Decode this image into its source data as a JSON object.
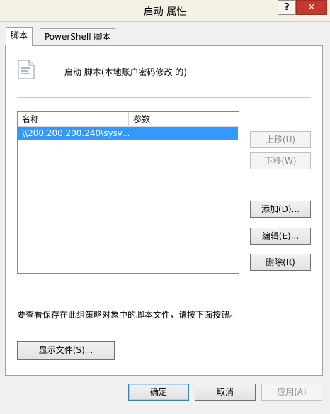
{
  "window": {
    "title": "启动 属性",
    "help_label": "?",
    "close_label": "✕"
  },
  "tabs": [
    {
      "label": "脚本",
      "active": true
    },
    {
      "label": "PowerShell 脚本",
      "active": false
    }
  ],
  "header": {
    "icon": "script-document-icon",
    "text": "启动 脚本(本地账户密码修改 的)"
  },
  "list": {
    "columns": [
      "名称",
      "参数"
    ],
    "rows": [
      {
        "name": "\\\\200.200.200.240\\sysv...",
        "params": ""
      }
    ]
  },
  "side_buttons": {
    "up": "上移(U)",
    "down": "下移(W)",
    "add": "添加(D)...",
    "edit": "编辑(E)...",
    "remove": "删除(R)"
  },
  "note": "要查看保存在此组策略对象中的脚本文件，请按下面按钮。",
  "show_files_label": "显示文件(S)...",
  "footer": {
    "ok": "确定",
    "cancel": "取消",
    "apply": "应用(A)"
  }
}
